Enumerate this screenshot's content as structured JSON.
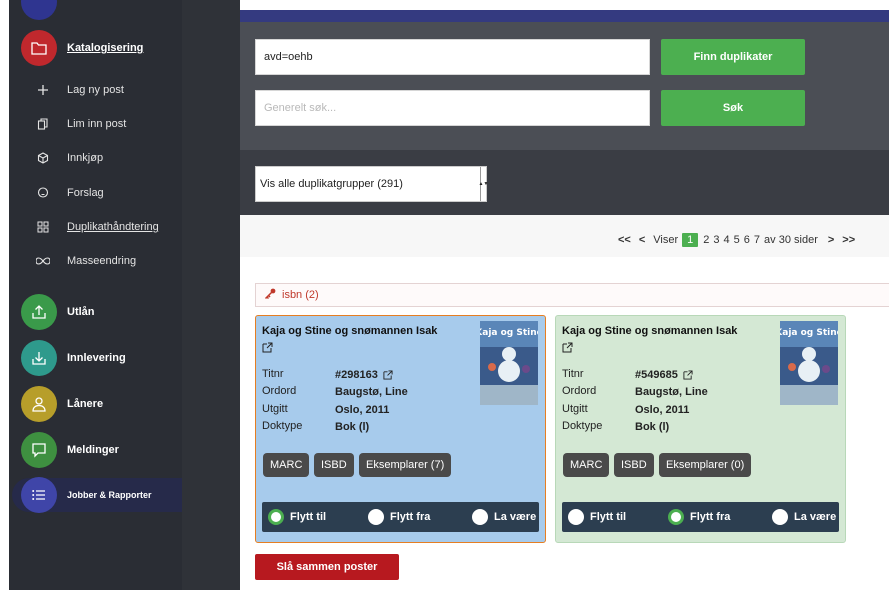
{
  "sidebar": {
    "main": [
      {
        "label": "Katalogisering",
        "color": "#c0282d",
        "icon": "folder-icon"
      },
      {
        "label": "Utlån",
        "color": "#3a9a4a",
        "icon": "upload-icon"
      },
      {
        "label": "Innlevering",
        "color": "#2e9a8c",
        "icon": "download-icon"
      },
      {
        "label": "Lånere",
        "color": "#b79e2a",
        "icon": "user-icon"
      },
      {
        "label": "Meldinger",
        "color": "#3e9040",
        "icon": "chat-icon"
      },
      {
        "label": "Jobber & Rapporter",
        "color": "#3f45a8",
        "icon": "list-icon"
      }
    ],
    "sub": [
      {
        "label": "Lag ny post",
        "icon": "plus-icon"
      },
      {
        "label": "Lim inn post",
        "icon": "paste-icon"
      },
      {
        "label": "Innkjøp",
        "icon": "box-icon"
      },
      {
        "label": "Forslag",
        "icon": "bulb-icon"
      },
      {
        "label": "Duplikathåndtering",
        "icon": "grid-icon"
      },
      {
        "label": "Masseendring",
        "icon": "infinity-icon"
      }
    ]
  },
  "search": {
    "query_value": "avd=oehb",
    "general_placeholder": "Generelt søk...",
    "find_duplicates_label": "Finn duplikater",
    "search_label": "Søk"
  },
  "filter": {
    "selected": "Vis alle duplikatgrupper (291)"
  },
  "pagination": {
    "first": "<<",
    "prev": "<",
    "showing": "Viser",
    "pages": [
      "1",
      "2",
      "3",
      "4",
      "5",
      "6",
      "7"
    ],
    "of_label": "av 30 sider",
    "next": ">",
    "last": ">>"
  },
  "group": {
    "label": "isbn (2)"
  },
  "cards": [
    {
      "title": "Kaja og Stine og snømannen Isak",
      "fields": [
        {
          "key": "Titnr",
          "value": "#298163"
        },
        {
          "key": "Ordord",
          "value": "Baugstø, Line"
        },
        {
          "key": "Utgitt",
          "value": "Oslo, 2011"
        },
        {
          "key": "Doktype",
          "value": "Bok (l)"
        }
      ],
      "buttons": [
        "MARC",
        "ISBD",
        "Eksemplarer (7)"
      ],
      "radios": [
        "Flytt til",
        "Flytt fra",
        "La være"
      ],
      "selected_radio": "Flytt til"
    },
    {
      "title": "Kaja og Stine og snømannen Isak",
      "fields": [
        {
          "key": "Titnr",
          "value": "#549685"
        },
        {
          "key": "Ordord",
          "value": "Baugstø, Line"
        },
        {
          "key": "Utgitt",
          "value": "Oslo, 2011"
        },
        {
          "key": "Doktype",
          "value": "Bok (l)"
        }
      ],
      "buttons": [
        "MARC",
        "ISBD",
        "Eksemplarer (0)"
      ],
      "radios": [
        "Flytt til",
        "Flytt fra",
        "La være"
      ],
      "selected_radio": "Flytt fra"
    }
  ],
  "merge_label": "Slå sammen poster",
  "colors": {
    "accent_green": "#4caf50",
    "merge_red": "#b7191f",
    "selected_border": "#e67e22"
  }
}
